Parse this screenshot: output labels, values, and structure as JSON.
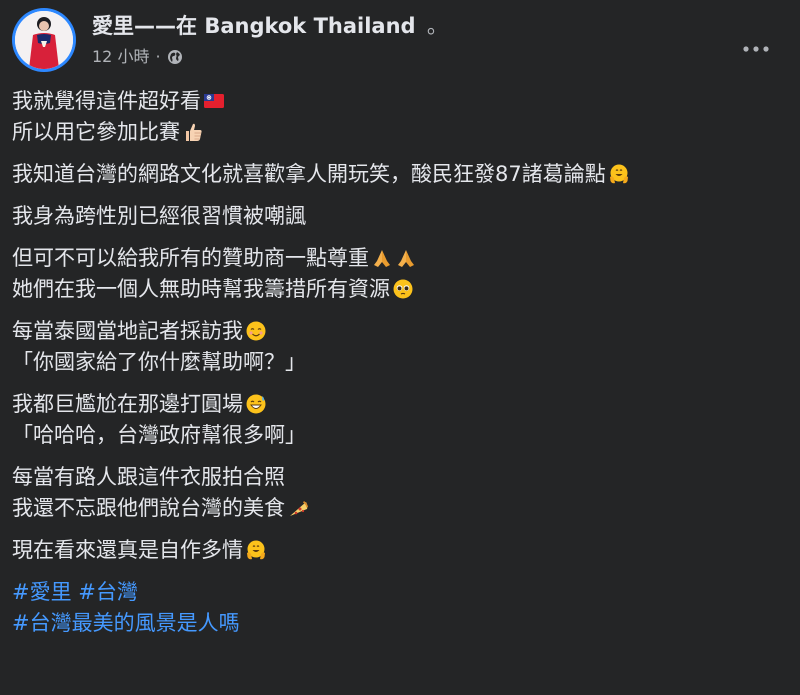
{
  "header": {
    "author_name": "愛里",
    "location_separator": "——在",
    "location": "Bangkok Thailand",
    "location_end": "。",
    "timestamp": "12 小時",
    "meta_separator": "·",
    "privacy_icon": "globe-icon",
    "more_icon": "more-options-icon"
  },
  "body": {
    "p1": {
      "l1": "我就覺得這件超好看",
      "l1_emoji": "taiwan-flag-emoji",
      "l2": "所以用它參加比賽",
      "l2_emoji": "thumbs-up-emoji"
    },
    "p2": {
      "l1": "我知道台灣的網路文化就喜歡拿人開玩笑，酸民狂發87諸葛論點",
      "l1_emoji": "hugging-face-emoji"
    },
    "p3": {
      "l1": "我身為跨性別已經很習慣被嘲諷"
    },
    "p4": {
      "l1": "但可不可以給我所有的贊助商一點尊重",
      "l1_emoji": "folded-hands-emoji",
      "l2": "她們在我一個人無助時幫我籌措所有資源",
      "l2_emoji": "pleading-face-emoji"
    },
    "p5": {
      "l1": "每當泰國當地記者採訪我",
      "l1_emoji": "smiling-face-emoji",
      "l2": "「你國家給了你什麼幫助啊？」"
    },
    "p6": {
      "l1": "我都巨尷尬在那邊打圓場",
      "l1_emoji": "grinning-sweat-emoji",
      "l2": "「哈哈哈，台灣政府幫很多啊」"
    },
    "p7": {
      "l1": "每當有路人跟這件衣服拍合照",
      "l2": "我還不忘跟他們說台灣的美食",
      "l2_emoji": "pizza-emoji"
    },
    "p8": {
      "l1": "現在看來還真是自作多情",
      "l1_emoji": "hugging-face-emoji"
    },
    "hashtags": {
      "tag1": "#愛里",
      "tag2": "#台灣",
      "tag3": "#台灣最美的風景是人嗎"
    }
  },
  "colors": {
    "background": "#242526",
    "text": "#e4e6eb",
    "secondary_text": "#b0b3b8",
    "hashtag": "#4599ff",
    "avatar_ring": "#2d88ff"
  }
}
